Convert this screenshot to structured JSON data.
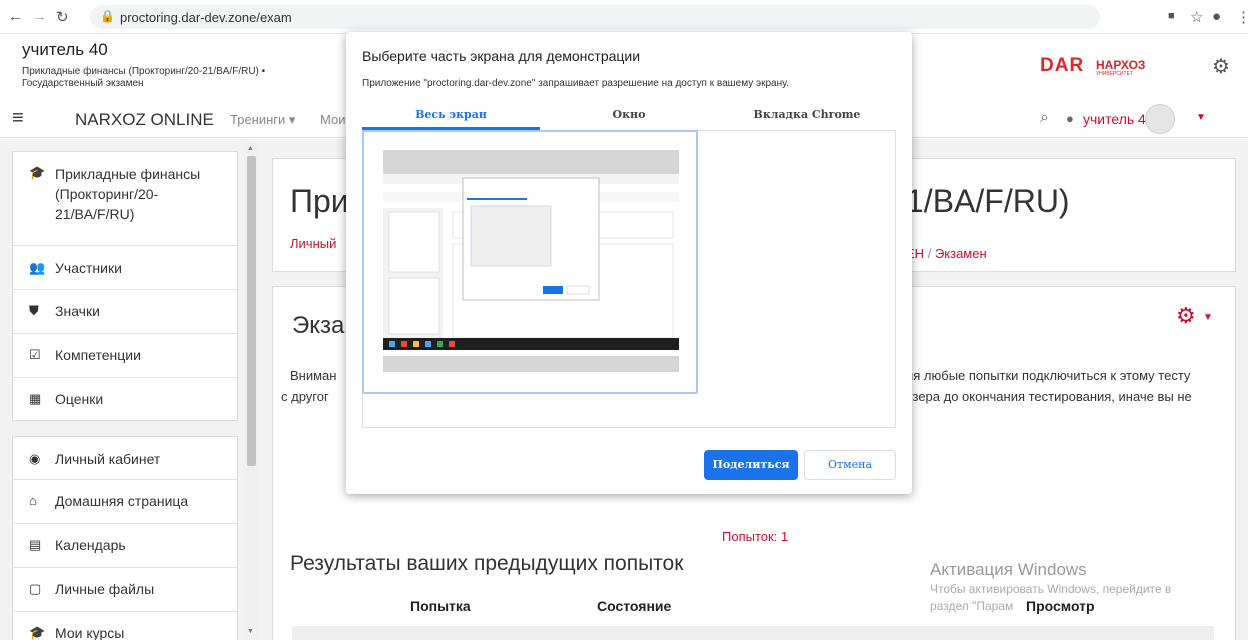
{
  "browser": {
    "url": "proctoring.dar-dev.zone/exam",
    "icons": [
      "back-icon",
      "forward-icon",
      "reload-icon",
      "lock-icon",
      "cast-icon",
      "star-icon",
      "profile-icon",
      "menu-icon"
    ]
  },
  "header": {
    "user_name": "учитель 40",
    "course_line1": "Прикладные финансы (Прокторинг/20-21/BA/F/RU) •",
    "course_line2": "Государственный экзамен",
    "logo_dar": "DAR",
    "logo_narxoz": "НАРХОЗ",
    "logo_sub": "УНИВЕРСИТЕТ"
  },
  "navbar": {
    "brand": "NARXOZ ONLINE",
    "trainings": "Тренинги ▾",
    "my_partial": "Мои",
    "user": "учитель 40"
  },
  "sidebar": {
    "block1": [
      {
        "icon": "graduation-cap-icon",
        "label": "Прикладные финансы (Прокторинг/20-21/BA/F/RU)"
      },
      {
        "icon": "users-icon",
        "label": "Участники"
      },
      {
        "icon": "shield-icon",
        "label": "Значки"
      },
      {
        "icon": "checkbox-icon",
        "label": "Компетенции"
      },
      {
        "icon": "table-icon",
        "label": "Оценки"
      }
    ],
    "block2": [
      {
        "icon": "dashboard-icon",
        "label": "Личный кабинет"
      },
      {
        "icon": "home-icon",
        "label": "Домашняя страница"
      },
      {
        "icon": "calendar-icon",
        "label": "Календарь"
      },
      {
        "icon": "file-icon",
        "label": "Личные файлы"
      },
      {
        "icon": "graduation-cap-icon",
        "label": "Мои курсы"
      }
    ]
  },
  "main": {
    "course_title_left": "При",
    "course_title_right": "1/BA/F/RU)",
    "crumb_left": "Личный",
    "crumb_right_prefix": "ЕН",
    "crumb_sep": "/",
    "crumb_exam": "Экзамен",
    "exam_title": "Экза",
    "warning_left_1": "Вниман",
    "warning_left_2": "с другог",
    "warning_right_1": "ия любые попытки подключиться к этому тесту",
    "warning_right_2": "узера до окончания тестирования, иначе вы не",
    "attempts": "Попыток: 1",
    "results_title": "Результаты ваших предыдущих попыток",
    "columns": [
      "Попытка",
      "Состояние",
      "Просмотр"
    ]
  },
  "windows_activation": {
    "title": "Активация Windows",
    "line1": "Чтобы активировать Windows, перейдите в",
    "line2": "раздел \"Парам"
  },
  "dialog": {
    "title": "Выберите часть экрана для демонстрации",
    "description": "Приложение \"proctoring.dar-dev.zone\" запрашивает разрешение на доступ к вашему экрану.",
    "tabs": [
      "Весь экран",
      "Окно",
      "Вкладка Chrome"
    ],
    "share": "Поделиться",
    "cancel": "Отмена"
  },
  "colors": {
    "accent_red": "#c8102e",
    "chrome_blue": "#1a73e8"
  }
}
